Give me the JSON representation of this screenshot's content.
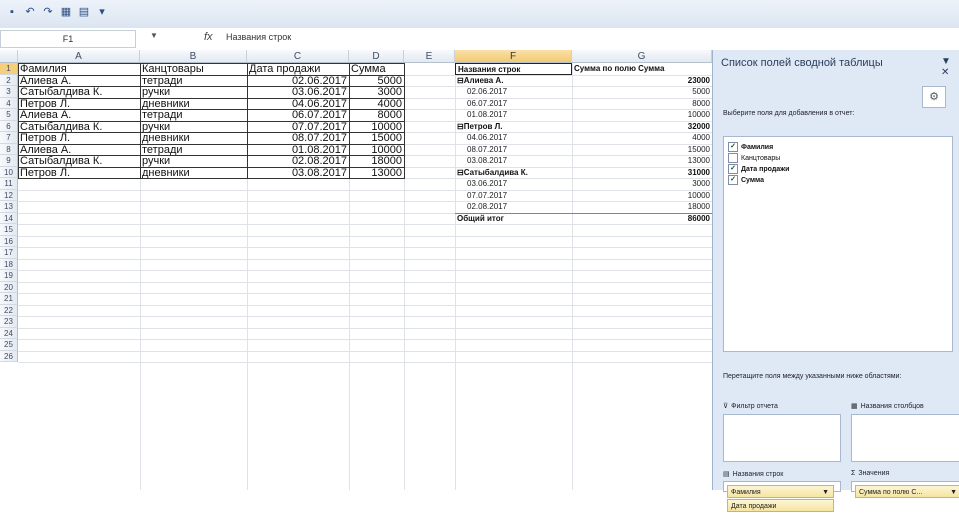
{
  "formula_bar": {
    "name_box": "F1",
    "fx": "fx",
    "value": "Названия строк"
  },
  "columns": [
    "A",
    "B",
    "C",
    "D",
    "E",
    "F",
    "G"
  ],
  "rows": [
    "1",
    "2",
    "3",
    "4",
    "5",
    "6",
    "7",
    "8",
    "9",
    "10",
    "11",
    "12",
    "13",
    "14",
    "15",
    "16",
    "17",
    "18",
    "19",
    "20",
    "21",
    "22",
    "23",
    "24",
    "25",
    "26"
  ],
  "table": {
    "headers": [
      "Фамилия",
      "Канцтовары",
      "Дата продажи",
      "Сумма"
    ],
    "rows": [
      [
        "Алиева А.",
        "тетради",
        "02.06.2017",
        "5000"
      ],
      [
        "Сатыбалдива К.",
        "ручки",
        "03.06.2017",
        "3000"
      ],
      [
        "Петров Л.",
        "дневники",
        "04.06.2017",
        "4000"
      ],
      [
        "Алиева А.",
        "тетради",
        "06.07.2017",
        "8000"
      ],
      [
        "Сатыбалдива К.",
        "ручки",
        "07.07.2017",
        "10000"
      ],
      [
        "Петров Л.",
        "дневники",
        "08.07.2017",
        "15000"
      ],
      [
        "Алиева А.",
        "тетради",
        "01.08.2017",
        "10000"
      ],
      [
        "Сатыбалдива К.",
        "ручки",
        "02.08.2017",
        "18000"
      ],
      [
        "Петров Л.",
        "дневники",
        "03.08.2017",
        "13000"
      ]
    ]
  },
  "pivot": {
    "header_rows": "Названия строк",
    "header_values": "Сумма по полю Сумма",
    "rows": [
      {
        "label": "⊟Алиева А.",
        "value": "23000",
        "kind": "group"
      },
      {
        "label": "02.06.2017",
        "value": "5000",
        "kind": "item"
      },
      {
        "label": "06.07.2017",
        "value": "8000",
        "kind": "item"
      },
      {
        "label": "01.08.2017",
        "value": "10000",
        "kind": "item"
      },
      {
        "label": "⊟Петров Л.",
        "value": "32000",
        "kind": "group"
      },
      {
        "label": "04.06.2017",
        "value": "4000",
        "kind": "item"
      },
      {
        "label": "08.07.2017",
        "value": "15000",
        "kind": "item"
      },
      {
        "label": "03.08.2017",
        "value": "13000",
        "kind": "item"
      },
      {
        "label": "⊟Сатыбалдива К.",
        "value": "31000",
        "kind": "group"
      },
      {
        "label": "03.06.2017",
        "value": "3000",
        "kind": "item"
      },
      {
        "label": "07.07.2017",
        "value": "10000",
        "kind": "item"
      },
      {
        "label": "02.08.2017",
        "value": "18000",
        "kind": "item"
      },
      {
        "label": "Общий итог",
        "value": "86000",
        "kind": "total"
      }
    ]
  },
  "panel": {
    "title": "Список полей сводной таблицы",
    "prompt": "Выберите поля для добавления в отчет:",
    "fields": [
      {
        "label": "Фамилия",
        "checked": true
      },
      {
        "label": "Канцтовары",
        "checked": false
      },
      {
        "label": "Дата продажи",
        "checked": true
      },
      {
        "label": "Сумма",
        "checked": true
      }
    ],
    "drag_text": "Перетащите поля между указанными ниже областями:",
    "area_filter": "Фильтр отчета",
    "area_columns": "Названия столбцов",
    "area_rows": "Названия строк",
    "area_values": "Значения",
    "row_chips": [
      "Фамилия",
      "Дата продажи"
    ],
    "value_chips": [
      "Сумма по полю С..."
    ]
  }
}
